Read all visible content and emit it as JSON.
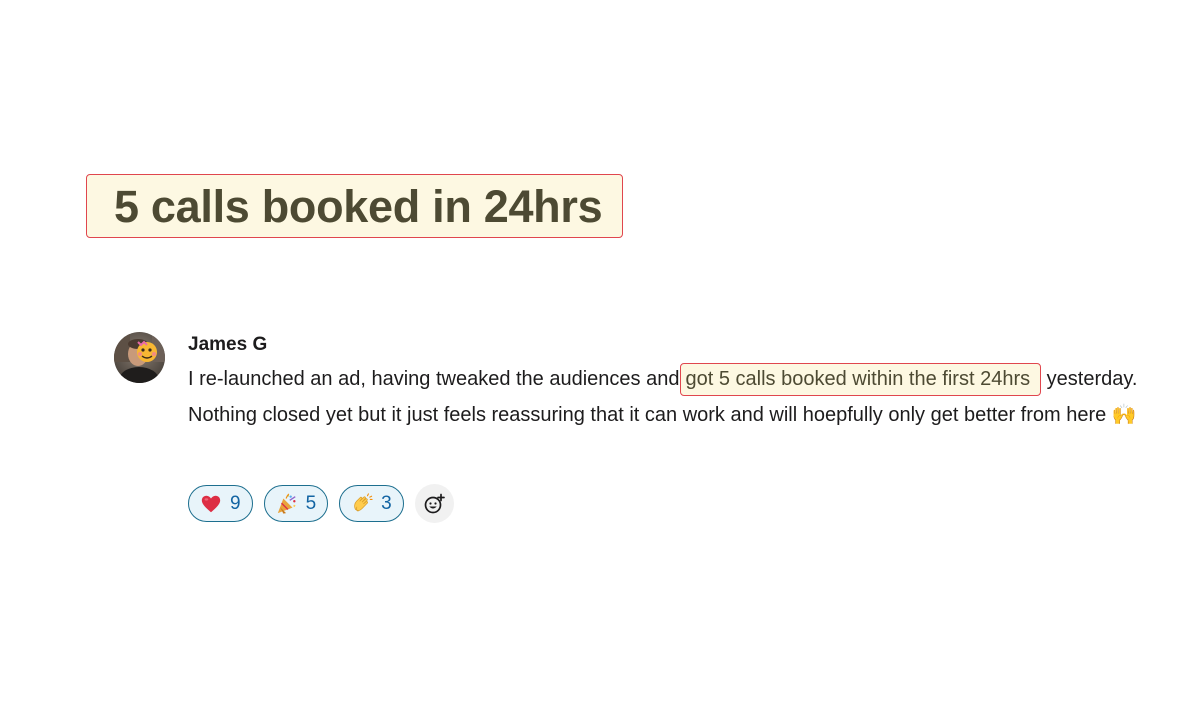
{
  "headline": {
    "text": "5 calls booked in 24hrs"
  },
  "message": {
    "author": "James G",
    "avatar_icon": "user-avatar",
    "text_before": "I re-launched an ad, having tweaked the audiences and",
    "highlight": "got 5 calls booked within the first 24hrs",
    "text_after": " yesterday. Nothing closed yet but it just feels reassuring that it can work and will hoepfully only get better from here ",
    "trailing_emoji": "🙌",
    "reactions": [
      {
        "icon": "heart-emoji",
        "count": "9"
      },
      {
        "icon": "party-popper-emoji",
        "count": "5"
      },
      {
        "icon": "clapping-hands-emoji",
        "count": "3"
      }
    ],
    "add_reaction_icon": "add-reaction-icon"
  },
  "colors": {
    "highlight_fill": "#fdf8e2",
    "highlight_border": "#e0464e",
    "reaction_border": "#1d6f8f",
    "reaction_fill": "#e8f4fa",
    "reaction_count": "#1264a3"
  }
}
